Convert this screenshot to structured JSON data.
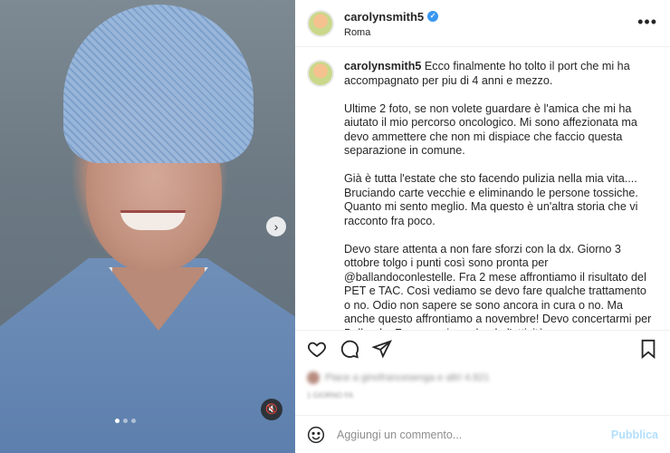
{
  "post": {
    "username": "carolynsmith5",
    "location": "Roma",
    "more_icon": "more-horizontal-icon"
  },
  "caption": {
    "username": "carolynsmith5",
    "paragraphs": [
      "Ecco finalmente ho tolto il port che mi ha accompagnato per piu di 4 anni e mezzo.",
      "Ultime 2 foto, se non volete guardare è l'amica che mi ha aiutato il mio percorso oncologico. Mi sono affezionata ma devo ammettere che non mi dispiace che faccio questa separazione in comune.",
      "Già è tutta l'estate che sto facendo pulizia nella mia vita.... Bruciando carte vecchie e eliminando le persone tossiche. Quanto mi sento meglio. Ma questo è un'altra storia che vi racconto fra poco.",
      "Devo stare attenta a non fare sforzi con la dx. Giorno 3 ottobre tolgo i punti così sono pronta per @ballandoconlestelle. Fra 2 mese affrontiamo il risultato del PET e TAC. Così vediamo se devo fare qualche trattamento o no. Odio non sapere se sono ancora in cura o no. Ma anche questo affrontiamo a novembre! Devo concertarmi per Ballando. Fra poco riprendendo l'attività"
    ]
  },
  "media": {
    "slide_count": 3,
    "active_slide": 1,
    "next_arrow": "›",
    "mute_glyph": "🔇"
  },
  "likes": {
    "liked_by_text": "Piace a ginofrancesenga e altri 4.821",
    "time_text": "1 GIORNO FA"
  },
  "comment": {
    "placeholder": "Aggiungi un commento...",
    "publish_label": "Pubblica"
  }
}
